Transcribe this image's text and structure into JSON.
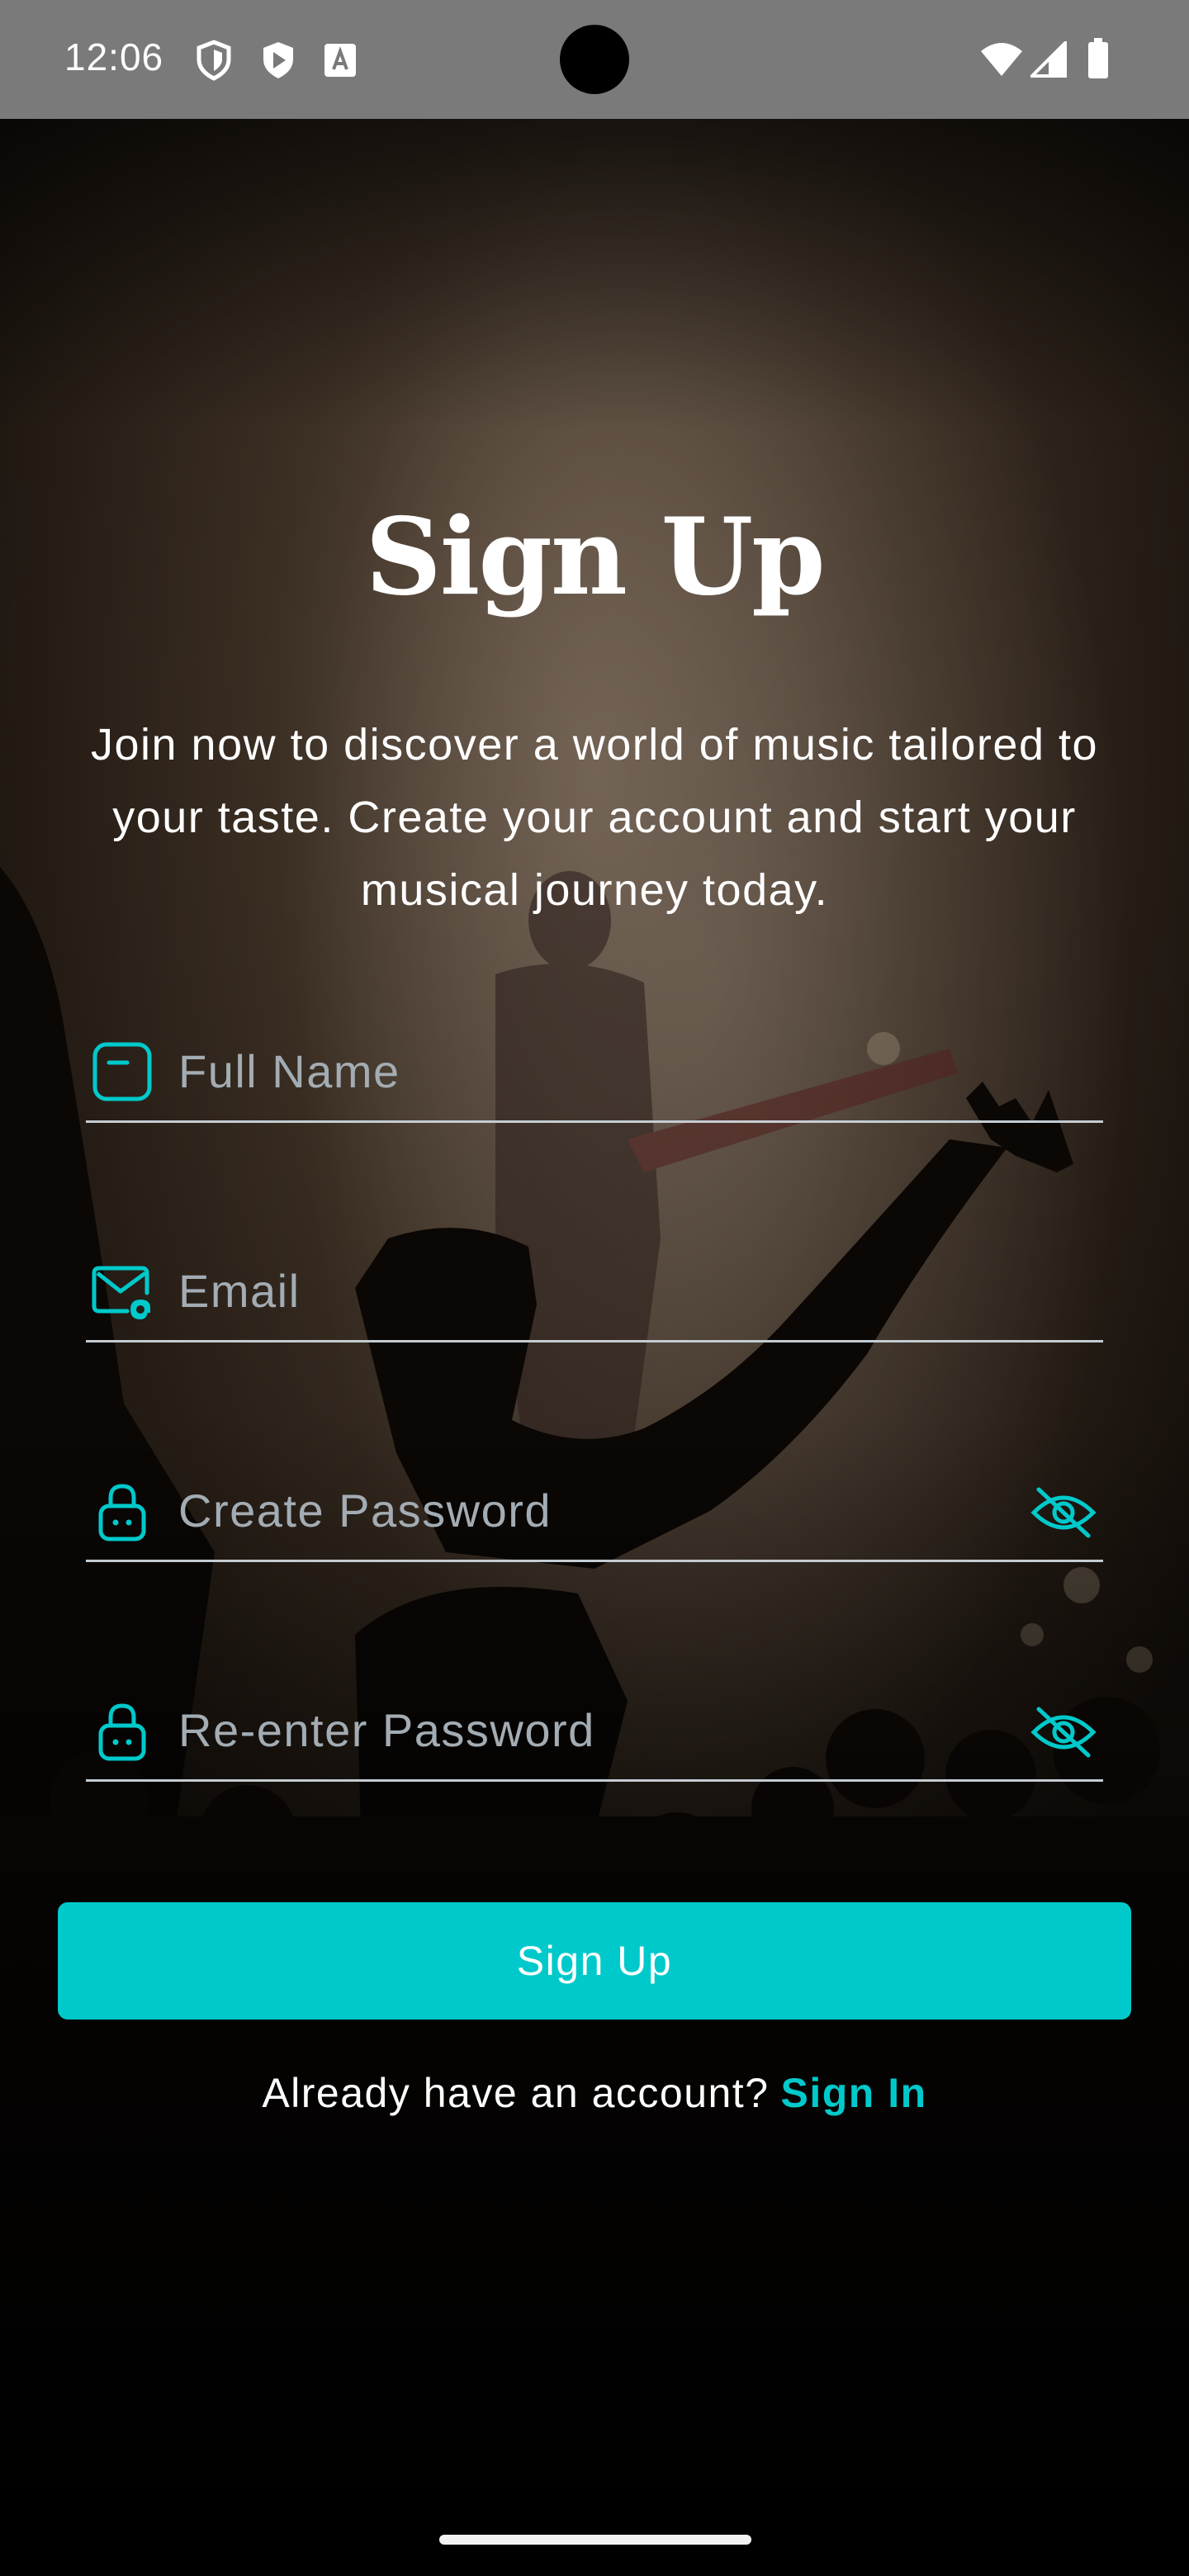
{
  "status_bar": {
    "time": "12:06",
    "left_icons": [
      "shield-icon",
      "play-protect-icon",
      "keyboard-a-icon"
    ],
    "right_icons": [
      "wifi-icon",
      "cellular-signal-icon",
      "battery-icon"
    ]
  },
  "signup": {
    "title": "Sign Up",
    "subtitle": "Join now to discover a world of music tailored to your taste. Create your account and start your musical journey today.",
    "fields": {
      "full_name": {
        "placeholder": "Full Name",
        "value": "",
        "icon": "name-card-icon"
      },
      "email": {
        "placeholder": "Email",
        "value": "",
        "icon": "email-at-icon"
      },
      "create_password": {
        "placeholder": "Create Password",
        "value": "",
        "icon": "lock-icon",
        "toggle_icon": "eye-off-icon"
      },
      "reenter_password": {
        "placeholder": "Re-enter Password",
        "value": "",
        "icon": "lock-icon",
        "toggle_icon": "eye-off-icon"
      }
    },
    "button_label": "Sign Up",
    "signin_prompt": "Already have an account?",
    "signin_link": "Sign In"
  },
  "colors": {
    "accent": "#00c9cb",
    "text": "#ffffff",
    "placeholder": "#a3acb3",
    "divider": "#c4ccd2",
    "status_bar": "#7a7a7a"
  }
}
